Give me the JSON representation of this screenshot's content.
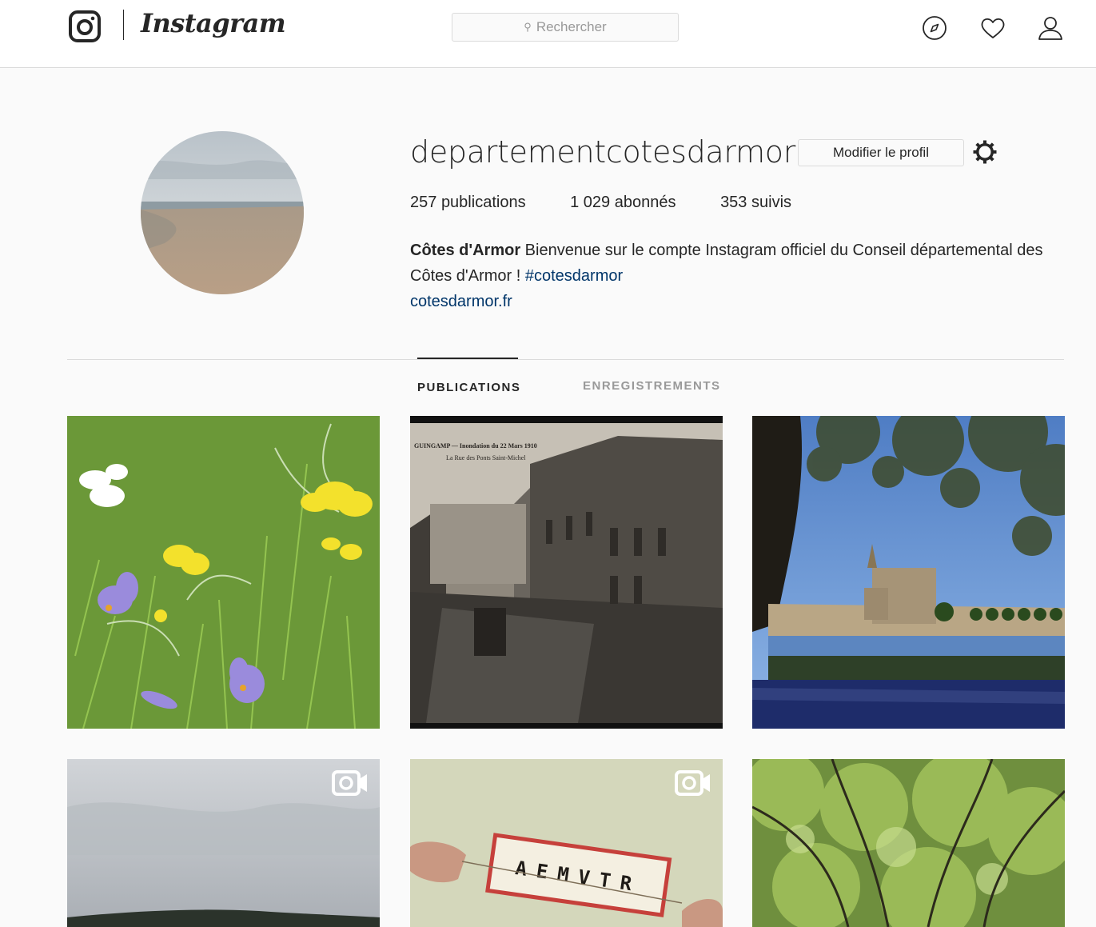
{
  "nav": {
    "brand": "Instagram",
    "search_placeholder": "Rechercher",
    "icons": [
      "instagram-logo-icon",
      "compass-icon",
      "heart-icon",
      "person-icon"
    ]
  },
  "profile": {
    "username": "departementcotesdarmor",
    "edit_button": "Modifier le profil",
    "stats": {
      "posts": "257",
      "posts_label": "publications",
      "followers": "1 029",
      "followers_label": "abonnés",
      "following": "353",
      "following_label": "suivis"
    },
    "bio": {
      "name": "Côtes d'Armor",
      "text": " Bienvenue sur le compte Instagram officiel du Conseil départemental des Côtes d'Armor ! ",
      "hashtag": "#cotesdarmor",
      "website": "cotesdarmor.fr"
    }
  },
  "tabs": [
    {
      "label": "PUBLICATIONS",
      "active": true
    },
    {
      "label": "ENREGISTREMENTS",
      "active": false
    }
  ],
  "posts": [
    {
      "subject": "crocus flowers in grass",
      "video": false
    },
    {
      "subject": "old postcard flooded street",
      "video": false,
      "caption": "GUINGAMP — Inondation du 22 Mars 1910",
      "caption2": "La Rue des Ponts Saint-Michel"
    },
    {
      "subject": "castle by the water under trees",
      "video": false
    },
    {
      "subject": "cloudy beach",
      "video": true
    },
    {
      "subject": "letter card held by fingers",
      "video": true,
      "card_text": "AEMVTR"
    },
    {
      "subject": "forest canopy",
      "video": false
    }
  ],
  "colors": {
    "text": "#262626",
    "muted": "#999999",
    "link": "#003569",
    "border": "#dbdbdb",
    "background": "#fafafa"
  }
}
